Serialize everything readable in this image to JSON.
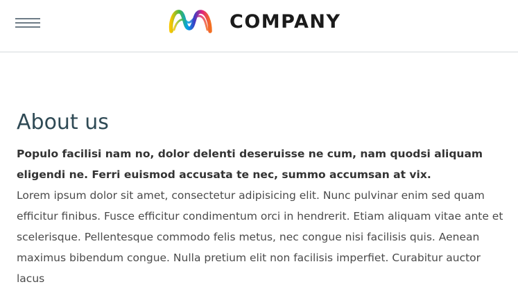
{
  "header": {
    "brand_name": "COMPANY",
    "logo_colors": [
      "#f7c600",
      "#45b649",
      "#00a2e8",
      "#3c3dc4",
      "#e2247a",
      "#f36f21"
    ]
  },
  "main": {
    "title": "About us",
    "lead": "Populo facilisi nam no, dolor delenti deseruisse ne cum, nam quodsi aliquam eligendi ne. Ferri euismod accusata te nec, summo accumsan at vix.",
    "body": "Lorem ipsum dolor sit amet, consectetur adipisicing elit. Nunc pulvinar enim sed quam efficitur finibus. Fusce efficitur condimentum orci in hendrerit. Etiam aliquam vitae ante et scelerisque. Pellentesque commodo felis metus, nec congue nisi facilisis quis. Aenean maximus bibendum congue. Nulla pretium elit non facilisis imperfiet. Curabitur auctor lacus"
  }
}
